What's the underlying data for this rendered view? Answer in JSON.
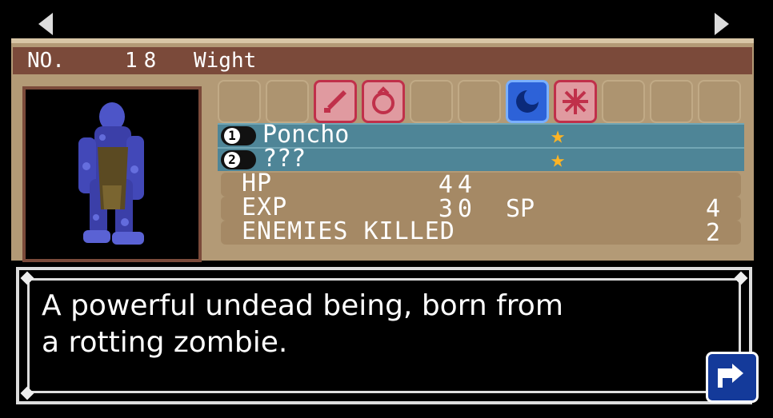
{
  "header": {
    "no_label": "NO.",
    "number": "18",
    "name": "Wight"
  },
  "resistances": [
    {
      "icon": "empty-slot",
      "active": false
    },
    {
      "icon": "empty-slot",
      "active": false
    },
    {
      "icon": "sword-icon",
      "active": true,
      "color": "red"
    },
    {
      "icon": "strike-icon",
      "active": true,
      "color": "red"
    },
    {
      "icon": "empty-slot",
      "active": false
    },
    {
      "icon": "empty-slot",
      "active": false
    },
    {
      "icon": "moon-icon",
      "active": true,
      "color": "blue"
    },
    {
      "icon": "holy-icon",
      "active": true,
      "color": "red"
    },
    {
      "icon": "empty-slot",
      "active": false
    },
    {
      "icon": "empty-slot",
      "active": false
    },
    {
      "icon": "empty-slot",
      "active": false
    }
  ],
  "souls": [
    {
      "slot": "1",
      "name": "Poncho",
      "star": "★"
    },
    {
      "slot": "2",
      "name": "???",
      "star": "★"
    }
  ],
  "stats": {
    "hp_label": "HP",
    "hp_value": "44",
    "exp_label": "EXP",
    "exp_value": "30",
    "sp_label": "SP",
    "sp_value": "4",
    "killed_label": "ENEMIES KILLED",
    "killed_value": "2"
  },
  "description": "A powerful undead being, born from\na rotting zombie.",
  "colors": {
    "panel": "#b39a76",
    "header": "#7b4a3a",
    "soul_row": "#4e8597",
    "star": "#ffb424"
  }
}
